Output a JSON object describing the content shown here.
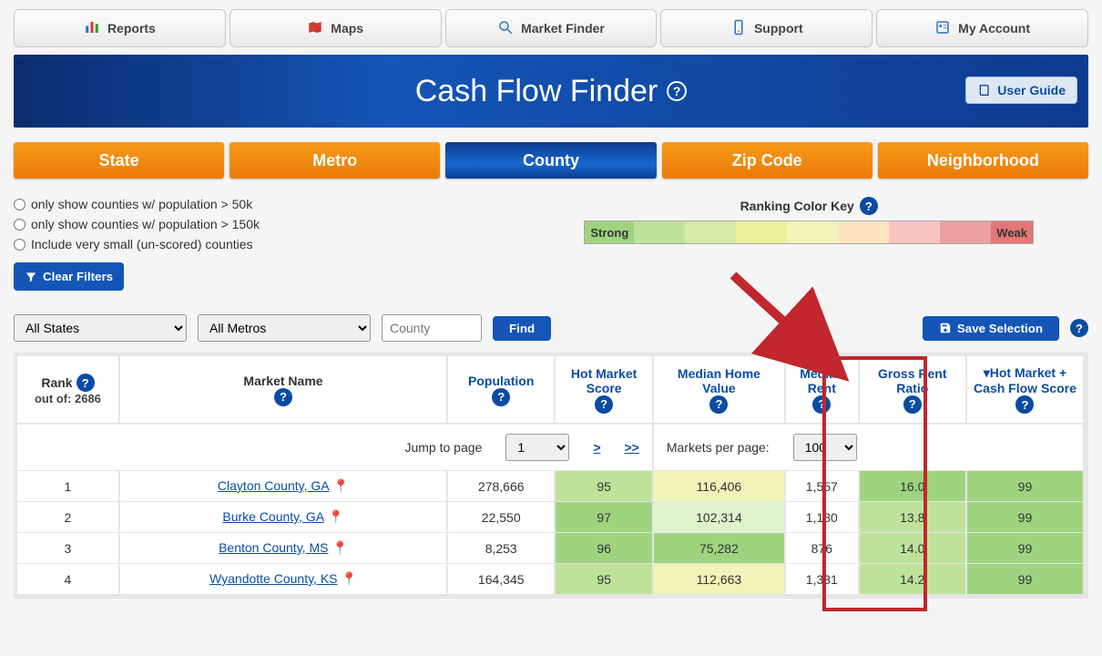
{
  "topnav": [
    {
      "label": "Reports",
      "icon": "reports"
    },
    {
      "label": "Maps",
      "icon": "maps"
    },
    {
      "label": "Market Finder",
      "icon": "search"
    },
    {
      "label": "Support",
      "icon": "phone"
    },
    {
      "label": "My Account",
      "icon": "account"
    }
  ],
  "header": {
    "title": "Cash Flow Finder",
    "user_guide": "User Guide"
  },
  "tabs": {
    "items": [
      "State",
      "Metro",
      "County",
      "Zip Code",
      "Neighborhood"
    ],
    "active_index": 2
  },
  "filters": {
    "radios": [
      "only show counties w/ population > 50k",
      "only show counties w/ population > 150k",
      "Include very small (un-scored) counties"
    ],
    "clear": "Clear Filters"
  },
  "colorkey": {
    "title": "Ranking Color Key",
    "strong": "Strong",
    "weak": "Weak",
    "colors": [
      "#9fd47f",
      "#bfe29b",
      "#d8eaa7",
      "#edf09b",
      "#f2f3b8",
      "#fbe5c0",
      "#f6c5c2",
      "#eaa0a0",
      "#e47676"
    ]
  },
  "controls": {
    "states": "All States",
    "metros": "All Metros",
    "county_placeholder": "County",
    "find": "Find",
    "save": "Save Selection"
  },
  "columns": {
    "rank_label": "Rank",
    "rank_sub": "out of: 2686",
    "name": "Market Name",
    "population": "Population",
    "hms": "Hot Market Score",
    "mhv": "Median Home Value",
    "rent": "Median Rent",
    "grr": "Gross Rent Ratio",
    "score": "Hot Market + Cash Flow Score"
  },
  "pager": {
    "jump_label": "Jump to page",
    "jump_value": "1",
    "next_one": ">",
    "next_many": ">>",
    "perpage_label": "Markets per page:",
    "perpage_value": "100"
  },
  "rows": [
    {
      "rank": "1",
      "name": "Clayton County, GA",
      "pop": "278,666",
      "hms": "95",
      "mhv": "116,406",
      "rent": "1,557",
      "grr": "16.0",
      "score": "99",
      "cls": {
        "hms": "c-strong2",
        "mhv": "c-mid2",
        "grr": "c-strong",
        "score": "c-strong"
      }
    },
    {
      "rank": "2",
      "name": "Burke County, GA",
      "pop": "22,550",
      "hms": "97",
      "mhv": "102,314",
      "rent": "1,180",
      "grr": "13.8",
      "score": "99",
      "cls": {
        "hms": "c-strong",
        "mhv": "c-pale",
        "grr": "c-strong2",
        "score": "c-strong"
      }
    },
    {
      "rank": "3",
      "name": "Benton County, MS",
      "pop": "8,253",
      "hms": "96",
      "mhv": "75,282",
      "rent": "876",
      "grr": "14.0",
      "score": "99",
      "cls": {
        "hms": "c-strong",
        "mhv": "c-strong",
        "grr": "c-strong2",
        "score": "c-strong"
      }
    },
    {
      "rank": "4",
      "name": "Wyandotte County, KS",
      "pop": "164,345",
      "hms": "95",
      "mhv": "112,663",
      "rent": "1,331",
      "grr": "14.2",
      "score": "99",
      "cls": {
        "hms": "c-strong2",
        "mhv": "c-mid2",
        "grr": "c-strong2",
        "score": "c-strong"
      }
    }
  ]
}
